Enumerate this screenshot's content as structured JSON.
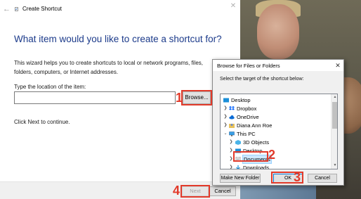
{
  "wizard": {
    "title": "Create Shortcut",
    "heading": "What item would you like to create a shortcut for?",
    "description": "This wizard helps you to create shortcuts to local or network programs, files, folders, computers, or Internet addresses.",
    "location_label": "Type the location of the item:",
    "location_value": "",
    "browse_label": "Browse...",
    "hint": "Click Next to continue.",
    "next_label": "Next",
    "cancel_label": "Cancel"
  },
  "dialog": {
    "title": "Browse for Files or Folders",
    "instruction": "Select the target of the shortcut below:",
    "tree": [
      {
        "label": "Desktop",
        "icon": "desktop-folder-icon"
      },
      {
        "label": "Dropbox",
        "icon": "dropbox-icon"
      },
      {
        "label": "OneDrive",
        "icon": "onedrive-cloud-icon"
      },
      {
        "label": "Diana Ann Roe",
        "icon": "user-folder-icon"
      },
      {
        "label": "This PC",
        "icon": "computer-icon"
      },
      {
        "label": "3D Objects",
        "icon": "3d-objects-icon"
      },
      {
        "label": "Desktop",
        "icon": "desktop-folder-icon"
      },
      {
        "label": "Documents",
        "icon": "documents-icon",
        "selected": true
      },
      {
        "label": "Downloads",
        "icon": "downloads-icon"
      }
    ],
    "make_folder_label": "Make New Folder",
    "ok_label": "OK",
    "cancel_label": "Cancel"
  },
  "annotations": [
    "1",
    "2",
    "3",
    "4"
  ],
  "colors": {
    "heading": "#1b3a8a",
    "annotation": "#e23a2a",
    "selection": "#cce8ff"
  }
}
